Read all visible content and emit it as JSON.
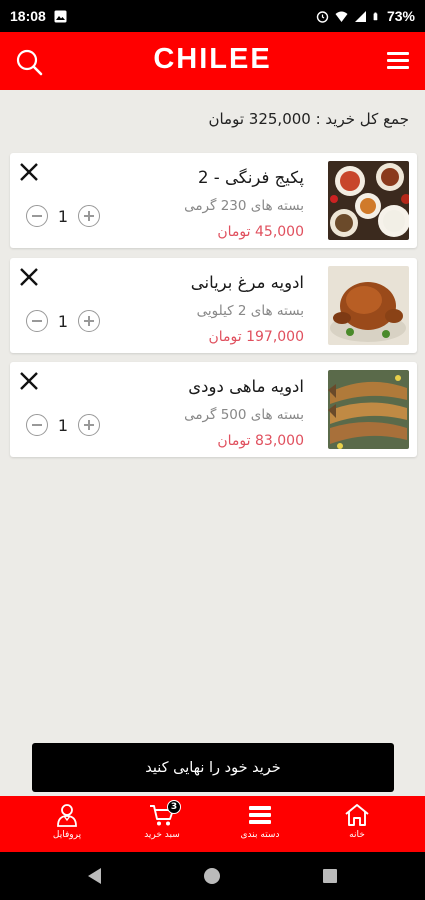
{
  "status_bar": {
    "time": "18:08",
    "battery": "73%"
  },
  "header": {
    "logo": "CHILEE"
  },
  "cart_total": {
    "label": "جمع کل خرید :",
    "amount": "325,000",
    "currency": "تومان"
  },
  "items": [
    {
      "name": "پکیج فرنگی - 2",
      "pack": "بسته های 230 گرمی",
      "price": "45,000 تومان",
      "qty": "1",
      "image": "dishes-photo"
    },
    {
      "name": "ادویه مرغ بریانی",
      "pack": "بسته های 2 کیلویی",
      "price": "197,000 تومان",
      "qty": "1",
      "image": "roast-chicken-photo"
    },
    {
      "name": "ادویه ماهی دودی",
      "pack": "بسته های 500 گرمی",
      "price": "83,000 تومان",
      "qty": "1",
      "image": "smoked-fish-photo"
    }
  ],
  "checkout": {
    "label": "خرید خود را نهایی کنید"
  },
  "bottom_nav": [
    {
      "label": "خانه",
      "icon": "home-icon"
    },
    {
      "label": "دسته بندی",
      "icon": "categories-icon"
    },
    {
      "label": "سبد خرید",
      "icon": "cart-icon",
      "badge": "3"
    },
    {
      "label": "پروفایل",
      "icon": "profile-icon"
    }
  ],
  "colors": {
    "brand": "#ff0000",
    "price": "#e0505e",
    "background": "#ecebe7",
    "button": "#000000"
  }
}
